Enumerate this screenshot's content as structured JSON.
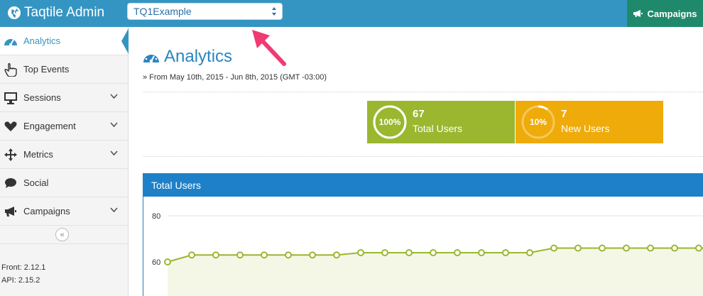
{
  "topbar": {
    "brand": "Taqtile Admin",
    "app_select_value": "TQ1Example",
    "campaigns_label": "Campaigns"
  },
  "sidebar": {
    "items": [
      {
        "label": "Analytics",
        "icon": "dashboard-icon",
        "active": true
      },
      {
        "label": "Top Events",
        "icon": "hand-pointer-icon"
      },
      {
        "label": "Sessions",
        "icon": "monitor-icon",
        "expandable": true
      },
      {
        "label": "Engagement",
        "icon": "heart-icon",
        "expandable": true
      },
      {
        "label": "Metrics",
        "icon": "move-arrows-icon",
        "expandable": true
      },
      {
        "label": "Social",
        "icon": "speech-bubble-icon"
      },
      {
        "label": "Campaigns",
        "icon": "megaphone-icon",
        "expandable": true
      }
    ],
    "collapse_glyph": "«",
    "front_version": "Front: 2.12.1",
    "api_version": "API: 2.15.2"
  },
  "main": {
    "title": "Analytics",
    "date_range": "» From May 10th, 2015 - Jun 8th, 2015 (GMT -03:00)",
    "kpis": [
      {
        "value": "67",
        "label": "Total Users",
        "percent": "100%",
        "fraction": 1.0,
        "color": "#9ab72f"
      },
      {
        "value": "7",
        "label": "New Users",
        "percent": "10%",
        "fraction": 0.1,
        "color": "#efab09"
      }
    ],
    "panel_title": "Total Users"
  },
  "colors": {
    "topbar": "#3595c2",
    "campaigns_button": "#1e8a6b",
    "panel_header": "#1e80c8",
    "line": "#9ab72f",
    "annotation_arrow": "#f03a73"
  },
  "chart_data": {
    "type": "area",
    "title": "Total Users",
    "y_tick_labels": [
      "80",
      "60"
    ],
    "values": [
      60,
      63,
      63,
      63,
      63,
      63,
      63,
      63,
      64,
      64,
      64,
      64,
      64,
      64,
      64,
      64,
      66,
      66,
      66,
      66,
      66,
      66,
      66,
      66
    ],
    "ylim_visible": [
      40,
      80
    ]
  }
}
